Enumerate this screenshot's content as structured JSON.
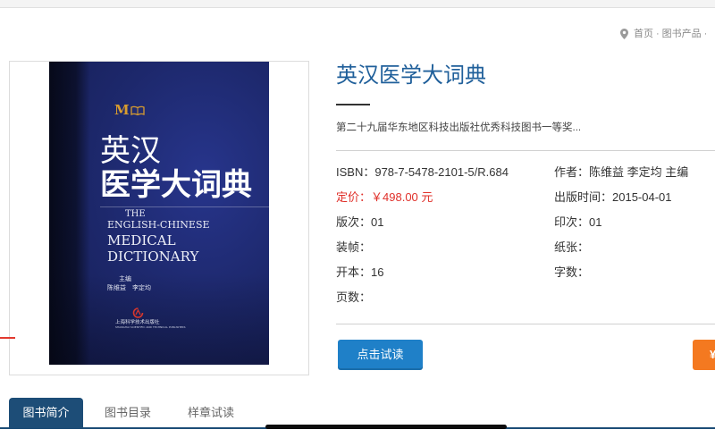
{
  "breadcrumb": {
    "home": "首页",
    "separator": "·",
    "section": "图书产品"
  },
  "cover": {
    "logo": "M",
    "title_cn_1": "英汉",
    "title_cn_2": "医学大词典",
    "title_en_1": "THE",
    "title_en_2": "ENGLISH-CHINESE",
    "title_en_3": "MEDICAL",
    "title_en_4": "DICTIONARY",
    "editor_role": "主编",
    "editors": "陈维益　李定均",
    "publisher": "上海科学技术出版社",
    "publisher_en": "SHANGHAI SCIENTIFIC AND TECHNICAL PUBLISHERS"
  },
  "book": {
    "title": "英汉医学大词典",
    "award": "第二十九届华东地区科技出版社优秀科技图书一等奖...",
    "details": {
      "isbn": {
        "label": "ISBN：",
        "value": "978-7-5478-2101-5/R.684"
      },
      "author": {
        "label": "作者：",
        "value": "陈维益 李定均 主编"
      },
      "price": {
        "label": "定价：",
        "value": "￥498.00 元"
      },
      "pub_date": {
        "label": "出版时间：",
        "value": "2015-04-01"
      },
      "edition": {
        "label": "版次：",
        "value": "01"
      },
      "printing": {
        "label": "印次：",
        "value": "01"
      },
      "binding": {
        "label": "装帧："
      },
      "paper": {
        "label": "纸张："
      },
      "format": {
        "label": "开本：",
        "value": "16"
      },
      "word_count": {
        "label": "字数："
      },
      "pages": {
        "label": "页数："
      }
    }
  },
  "actions": {
    "read_label": "点击试读",
    "buy_label": "¥"
  },
  "tabs": [
    {
      "label": "图书简介",
      "active": true
    },
    {
      "label": "图书目录",
      "active": false
    },
    {
      "label": "样章试读",
      "active": false
    }
  ],
  "colors": {
    "title_blue": "#1f5f9a",
    "button_blue": "#1f80c8",
    "price_red": "#e0302a",
    "buy_orange": "#f47920",
    "tab_blue": "#1d4d77",
    "logo_gold": "#d89c2f"
  }
}
